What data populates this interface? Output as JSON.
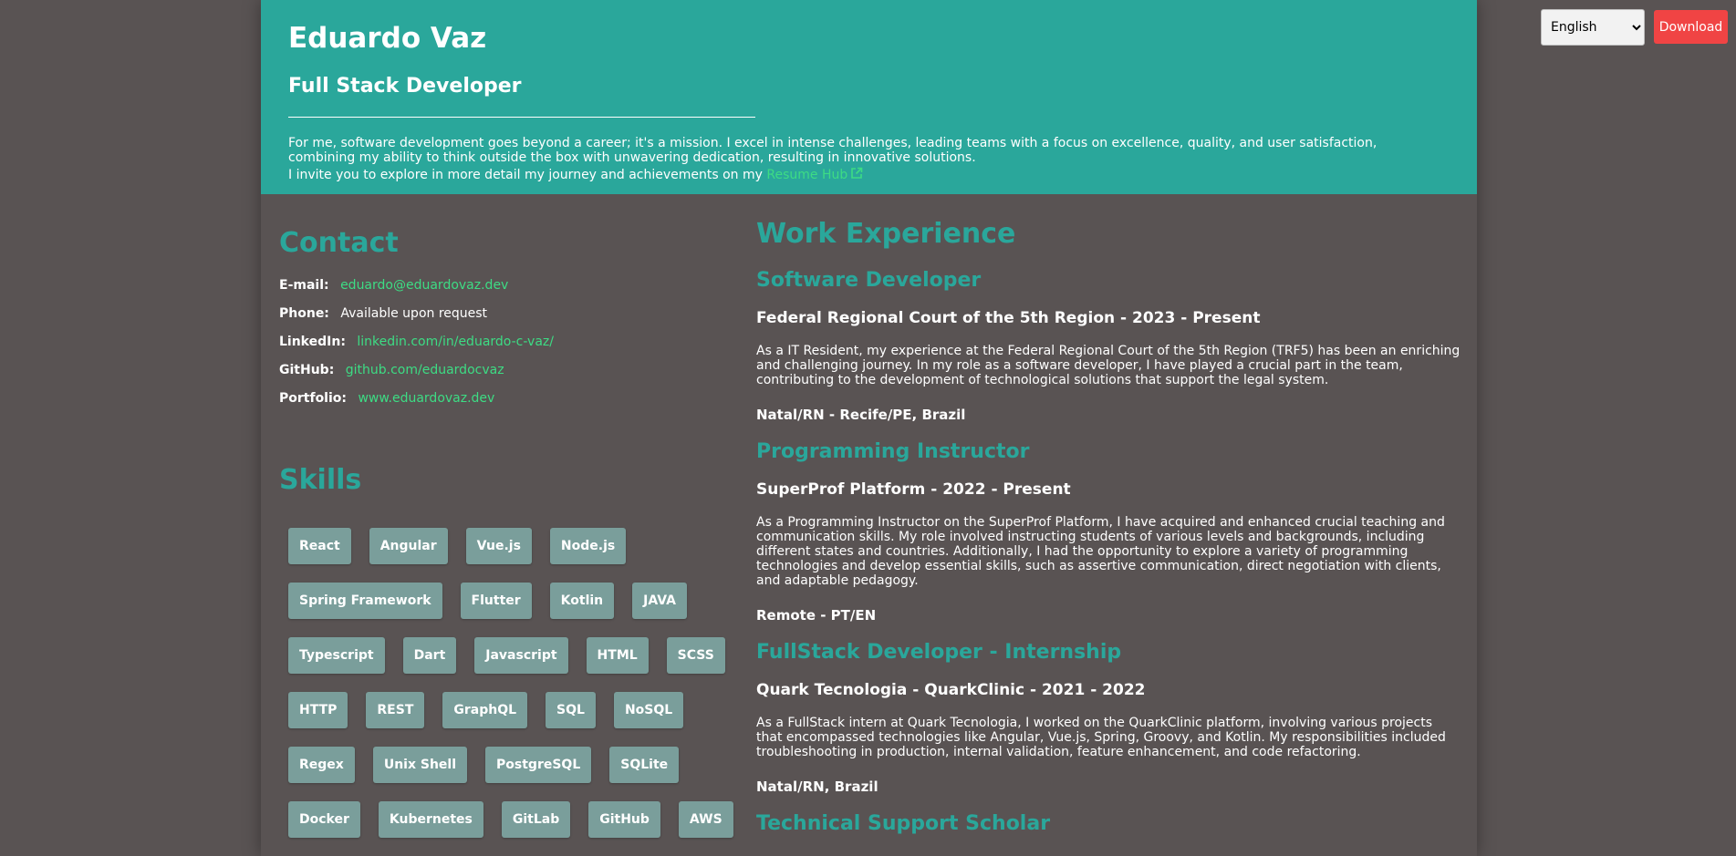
{
  "header": {
    "name": "Eduardo Vaz",
    "role": "Full Stack Developer",
    "bio": "For me, software development goes beyond a career; it's a mission. I excel in intense challenges, leading teams with a focus on excellence, quality, and user satisfaction, combining my ability to think outside the box with unwavering dedication, resulting in innovative solutions.",
    "invite_text": "I invite you to explore in more detail my journey and achievements on my",
    "resume_link_label": "Resume Hub",
    "resume_link_icon": "external-link-icon"
  },
  "toolbar": {
    "language_selected": "English",
    "download_label": "Download"
  },
  "contact": {
    "title": "Contact",
    "items": [
      {
        "label": "E-mail:",
        "value": "eduardo@eduardovaz.dev",
        "is_link": true
      },
      {
        "label": "Phone:",
        "value": "Available upon request",
        "is_link": false
      },
      {
        "label": "LinkedIn:",
        "value": "linkedin.com/in/eduardo-c-vaz/",
        "is_link": true
      },
      {
        "label": "GitHub:",
        "value": "github.com/eduardocvaz",
        "is_link": true
      },
      {
        "label": "Portfolio:",
        "value": "www.eduardovaz.dev",
        "is_link": true
      }
    ]
  },
  "skills": {
    "title": "Skills",
    "items": [
      "React",
      "Angular",
      "Vue.js",
      "Node.js",
      "Spring Framework",
      "Flutter",
      "Kotlin",
      "JAVA",
      "Typescript",
      "Dart",
      "Javascript",
      "HTML",
      "SCSS",
      "HTTP",
      "REST",
      "GraphQL",
      "SQL",
      "NoSQL",
      "Regex",
      "Unix Shell",
      "PostgreSQL",
      "SQLite",
      "Docker",
      "Kubernetes",
      "GitLab",
      "GitHub",
      "AWS"
    ]
  },
  "experience": {
    "title": "Work Experience",
    "jobs": [
      {
        "title": "Software Developer",
        "company": "Federal Regional Court of the 5th Region - 2023 - Present",
        "description": "As a IT Resident, my experience at the Federal Regional Court of the 5th Region (TRF5) has been an enriching and challenging journey. In my role as a software developer, I have played a crucial part in the team, contributing to the development of technological solutions that support the legal system.",
        "location": "Natal/RN - Recife/PE, Brazil"
      },
      {
        "title": "Programming Instructor",
        "company": "SuperProf Platform - 2022 - Present",
        "description": "As a Programming Instructor on the SuperProf Platform, I have acquired and enhanced crucial teaching and communication skills. My role involved instructing students of various levels and backgrounds, including different states and countries. Additionally, I had the opportunity to explore a variety of programming technologies and develop essential skills, such as assertive communication, direct negotiation with clients, and adaptable pedagogy.",
        "location": "Remote - PT/EN"
      },
      {
        "title": "FullStack Developer - Internship",
        "company": "Quark Tecnologia - QuarkClinic - 2021 - 2022",
        "description": "As a FullStack intern at Quark Tecnologia, I worked on the QuarkClinic platform, involving various projects that encompassed technologies like Angular, Vue.js, Spring, Groovy, and Kotlin. My responsibilities included troubleshooting in production, internal validation, feature enhancement, and code refactoring.",
        "location": "Natal/RN, Brazil"
      },
      {
        "title": "Technical Support Scholar"
      }
    ]
  },
  "colors": {
    "header_bg": "#2aa79b",
    "accent": "#2aa79b",
    "link": "#3ddc84",
    "chip_bg": "#7a9e9b",
    "page_bg": "#595353",
    "download_bg": "#f04444"
  }
}
